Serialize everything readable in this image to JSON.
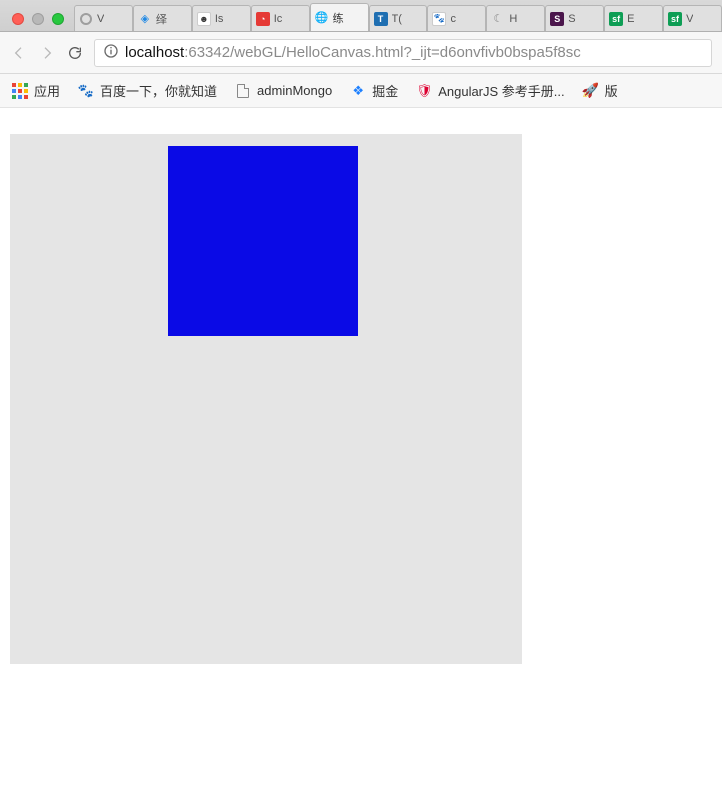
{
  "window": {
    "traffic_lights": [
      "close",
      "minimize",
      "maximize"
    ]
  },
  "tabs": [
    {
      "label": "V",
      "icon": "location-pin",
      "active": false
    },
    {
      "label": "绎",
      "icon": "cube-blue",
      "active": false
    },
    {
      "label": "Is",
      "icon": "github",
      "active": false
    },
    {
      "label": "Ic",
      "icon": "red-square",
      "active": false
    },
    {
      "label": "练",
      "icon": "globe-blue",
      "active": true
    },
    {
      "label": "T(",
      "icon": "blue-T",
      "active": false
    },
    {
      "label": "c",
      "icon": "paw-blue",
      "active": false
    },
    {
      "label": "H",
      "icon": "crescent",
      "active": false
    },
    {
      "label": "S",
      "icon": "slack",
      "active": false
    },
    {
      "label": "E",
      "icon": "sf-green",
      "active": false
    },
    {
      "label": "V",
      "icon": "sf-green",
      "active": false
    }
  ],
  "toolbar": {
    "back_enabled": false,
    "forward_enabled": false,
    "reload_enabled": true,
    "url_host_main": "localhost",
    "url_host_port": ":63342",
    "url_path": "/webGL/HelloCanvas.html?_ijt=d6onvfivb0bspa5f8sc"
  },
  "bookmarks": [
    {
      "icon": "apps",
      "label": "应用"
    },
    {
      "icon": "paw-blue",
      "label": "百度一下，你就知道"
    },
    {
      "icon": "doc",
      "label": "adminMongo"
    },
    {
      "icon": "juejin",
      "label": "掘金"
    },
    {
      "icon": "angular",
      "label": "AngularJS 参考手册..."
    },
    {
      "icon": "rocket",
      "label": "版"
    }
  ],
  "page": {
    "canvas": {
      "bg_color": "#e5e5e5",
      "square_color": "#0a0ae6"
    }
  }
}
